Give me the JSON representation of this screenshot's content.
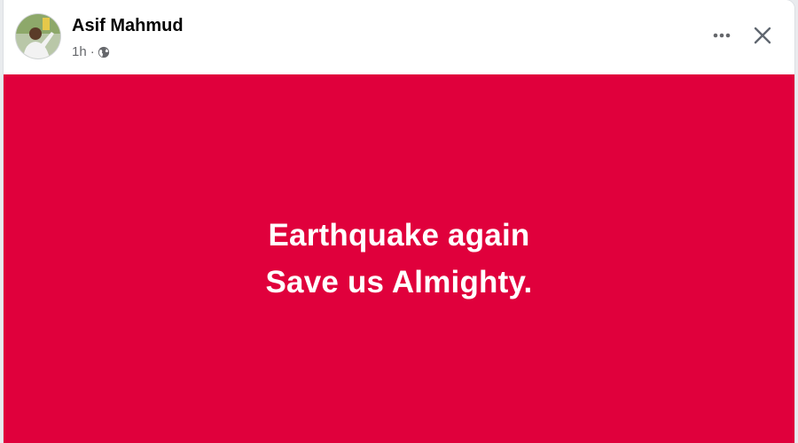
{
  "post": {
    "author_name": "Asif Mahmud",
    "timestamp": "1h",
    "separator": "·",
    "audience_icon": "globe-icon",
    "more_icon": "more-dots-icon",
    "close_icon": "close-icon",
    "background_color": "#e0003c",
    "text_color": "#ffffff",
    "text_lines": [
      "Earthquake again",
      "Save us Almighty."
    ]
  }
}
